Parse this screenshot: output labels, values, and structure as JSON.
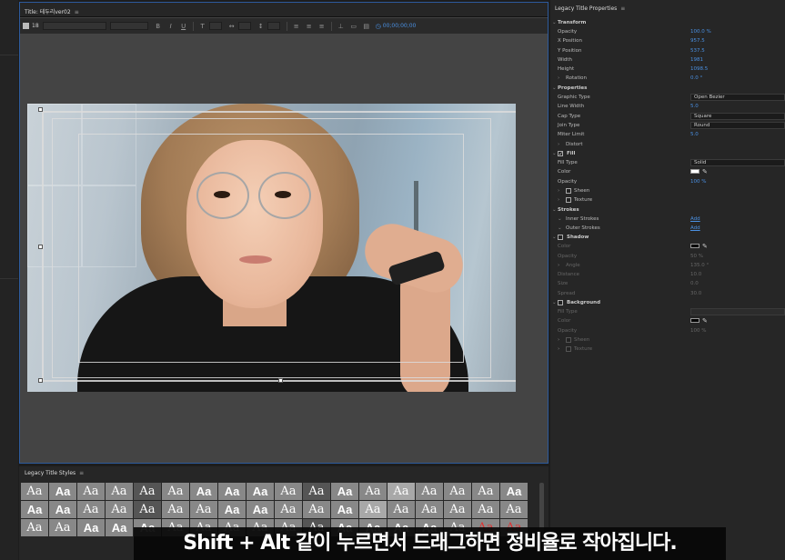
{
  "title_panel": {
    "tab_title": "Title: 테두리ver02",
    "font_size": "18",
    "timecode": "00;00;00;00"
  },
  "styles_panel": {
    "tab_title": "Legacy Title Styles",
    "swatch_label": "Aa"
  },
  "properties": {
    "tab_title": "Legacy Title Properties",
    "transform": {
      "label": "Transform",
      "opacity_label": "Opacity",
      "opacity": "100.0 %",
      "x_label": "X Position",
      "x": "957.5",
      "y_label": "Y Position",
      "y": "537.5",
      "width_label": "Width",
      "width": "1981",
      "height_label": "Height",
      "height": "1098.5",
      "rotation_label": "Rotation",
      "rotation": "0.0 °"
    },
    "props": {
      "label": "Properties",
      "graphic_type_label": "Graphic Type",
      "graphic_type": "Open Bezier",
      "line_width_label": "Line Width",
      "line_width": "5.0",
      "cap_type_label": "Cap Type",
      "cap_type": "Square",
      "join_type_label": "Join Type",
      "join_type": "Round",
      "miter_label": "Miter Limit",
      "miter": "5.0",
      "distort_label": "Distort"
    },
    "fill": {
      "label": "Fill",
      "type_label": "Fill Type",
      "type": "Solid",
      "color_label": "Color",
      "color": "#ffffff",
      "opacity_label": "Opacity",
      "opacity": "100 %",
      "sheen_label": "Sheen",
      "texture_label": "Texture"
    },
    "strokes": {
      "label": "Strokes",
      "inner_label": "Inner Strokes",
      "inner_add": "Add",
      "outer_label": "Outer Strokes",
      "outer_add": "Add"
    },
    "shadow": {
      "label": "Shadow",
      "color_label": "Color",
      "color": "#000000",
      "opacity_label": "Opacity",
      "opacity": "50 %",
      "angle_label": "Angle",
      "angle": "135.0 °",
      "distance_label": "Distance",
      "distance": "10.0",
      "size_label": "Size",
      "size": "0.0",
      "spread_label": "Spread",
      "spread": "30.0"
    },
    "background": {
      "label": "Background",
      "fill_type_label": "Fill Type",
      "color_label": "Color",
      "color": "#000000",
      "opacity_label": "Opacity",
      "opacity": "100 %",
      "sheen_label": "Sheen",
      "texture_label": "Texture"
    }
  },
  "caption": "Shift + Alt 같이 누르면서 드래그하면 정비율로 작아집니다."
}
